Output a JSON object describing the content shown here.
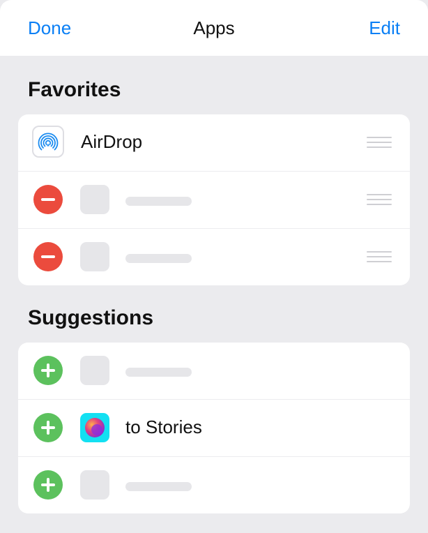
{
  "navbar": {
    "done_label": "Done",
    "title": "Apps",
    "edit_label": "Edit"
  },
  "favorites": {
    "title": "Favorites",
    "items": [
      {
        "label": "AirDrop",
        "icon": "airdrop-icon",
        "control": "none",
        "placeholder": false
      },
      {
        "label": "",
        "icon": "placeholder-icon",
        "control": "remove",
        "placeholder": true
      },
      {
        "label": "",
        "icon": "placeholder-icon",
        "control": "remove",
        "placeholder": true
      }
    ]
  },
  "suggestions": {
    "title": "Suggestions",
    "items": [
      {
        "label": "",
        "icon": "placeholder-icon",
        "control": "add",
        "placeholder": true
      },
      {
        "label": "to Stories",
        "icon": "stories-icon",
        "control": "add",
        "placeholder": false
      },
      {
        "label": "",
        "icon": "placeholder-icon",
        "control": "add",
        "placeholder": true
      }
    ]
  },
  "colors": {
    "accent": "#0a7ff5",
    "remove": "#eb4b3d",
    "add": "#5cc15d",
    "background": "#ebebee",
    "card": "#ffffff",
    "placeholder": "#e6e6e9"
  }
}
